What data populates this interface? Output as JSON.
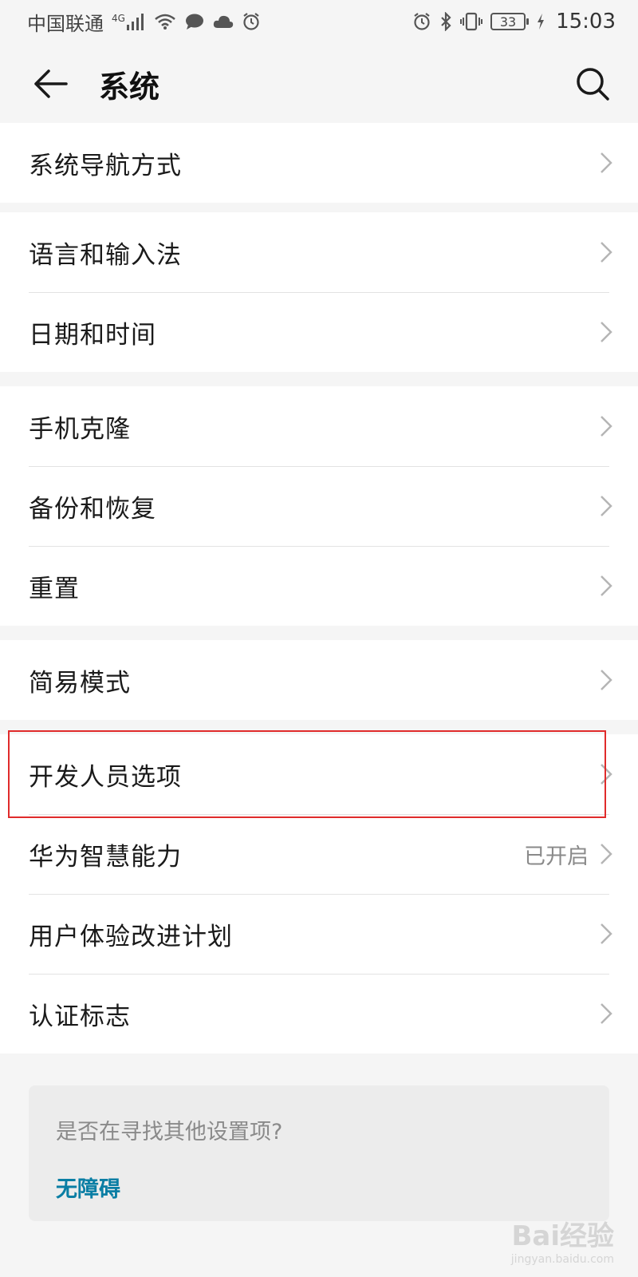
{
  "status_bar": {
    "carrier": "中国联通",
    "network_type": "4G",
    "battery": "33",
    "time": "15:03"
  },
  "header": {
    "title": "系统"
  },
  "groups": [
    {
      "items": [
        {
          "label": "系统导航方式"
        }
      ]
    },
    {
      "items": [
        {
          "label": "语言和输入法"
        },
        {
          "label": "日期和时间"
        }
      ]
    },
    {
      "items": [
        {
          "label": "手机克隆"
        },
        {
          "label": "备份和恢复"
        },
        {
          "label": "重置"
        }
      ]
    },
    {
      "items": [
        {
          "label": "简易模式"
        },
        {
          "label": "开发人员选项"
        },
        {
          "label": "华为智慧能力",
          "value": "已开启"
        },
        {
          "label": "用户体验改进计划"
        },
        {
          "label": "认证标志"
        }
      ]
    }
  ],
  "suggest": {
    "question": "是否在寻找其他设置项?",
    "link": "无障碍"
  },
  "watermark": {
    "brand": "Bai经验",
    "url": "jingyan.baidu.com"
  },
  "colors": {
    "highlight": "#e02b2b",
    "link": "#0a7ea4"
  }
}
